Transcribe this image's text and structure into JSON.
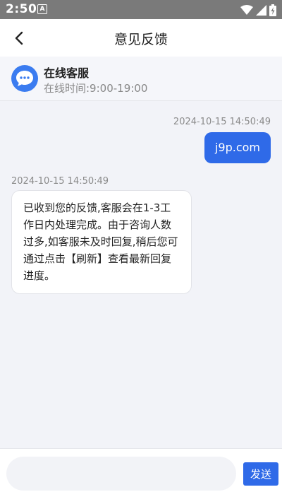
{
  "status_bar": {
    "time": "2:50",
    "notification_glyph": "A"
  },
  "nav": {
    "title": "意见反馈"
  },
  "service": {
    "name": "在线客服",
    "hours": "在线时间:9:00-19:00"
  },
  "messages": [
    {
      "from": "user",
      "time": "2024-10-15 14:50:49",
      "text": "j9p.com"
    },
    {
      "from": "service",
      "time": "2024-10-15 14:50:49",
      "text": "已收到您的反馈,客服会在1-3工作日内处理完成。由于咨询人数过多,如客服未及时回复,稍后您可通过点击【刷新】查看最新回复进度。"
    }
  ],
  "input": {
    "value": "",
    "placeholder": "",
    "send_label": "发送"
  },
  "colors": {
    "accent": "#2f6ae8",
    "avatar": "#3b7cf0",
    "status_bar": "#7a7a7a"
  }
}
